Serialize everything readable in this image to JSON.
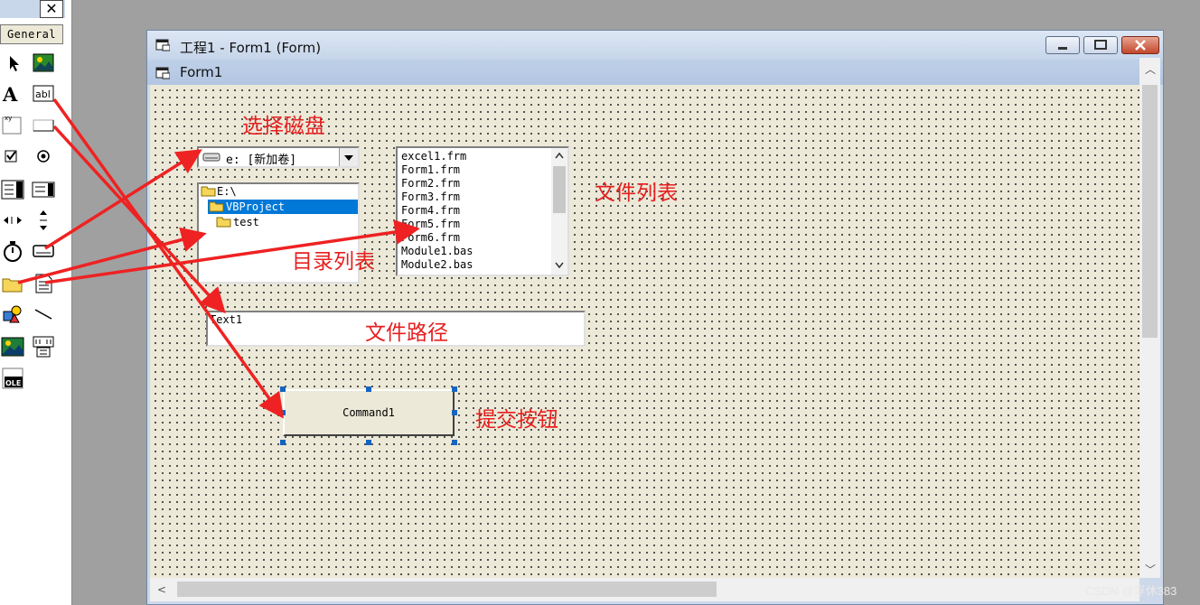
{
  "toolbox": {
    "tab_label": "General",
    "close_label": "✕",
    "tools": [
      {
        "name": "pointer-tool-icon"
      },
      {
        "name": "picturebox-tool-icon"
      },
      {
        "name": "label-tool-icon"
      },
      {
        "name": "textbox-tool-icon"
      },
      {
        "name": "frame-tool-icon"
      },
      {
        "name": "commandbutton-tool-icon"
      },
      {
        "name": "checkbox-tool-icon"
      },
      {
        "name": "optionbutton-tool-icon"
      },
      {
        "name": "combobox-tool-icon"
      },
      {
        "name": "listbox-tool-icon"
      },
      {
        "name": "hscrollbar-tool-icon"
      },
      {
        "name": "vscrollbar-tool-icon"
      },
      {
        "name": "timer-tool-icon"
      },
      {
        "name": "drivelistbox-tool-icon"
      },
      {
        "name": "dirlistbox-tool-icon"
      },
      {
        "name": "filelistbox-tool-icon"
      },
      {
        "name": "shape-tool-icon"
      },
      {
        "name": "line-tool-icon"
      },
      {
        "name": "image-tool-icon"
      },
      {
        "name": "data-tool-icon"
      },
      {
        "name": "ole-tool-icon"
      }
    ]
  },
  "window": {
    "title": "工程1 - Form1 (Form)",
    "form_caption": "Form1",
    "minimize_label": "▁",
    "maximize_label": "□",
    "close_label": "✕"
  },
  "controls": {
    "drive_value": "e: [新加卷]",
    "dir_items": [
      "E:\\",
      "VBProject",
      "test"
    ],
    "file_items": [
      "excel1.frm",
      "Form1.frm",
      "Form2.frm",
      "Form3.frm",
      "Form4.frm",
      "Form5.frm",
      "Form6.frm",
      "Module1.bas",
      "Module2.bas"
    ],
    "textbox_value": "Text1",
    "command_caption": "Command1"
  },
  "annotations": {
    "select_drive": "选择磁盘",
    "file_list": "文件列表",
    "dir_list": "目录列表",
    "file_path": "文件路径",
    "submit_button": "提交按钮"
  },
  "colors": {
    "annotation": "#e62020",
    "selection": "#0078d7",
    "selection_handle": "#1565c0"
  },
  "watermark": "CSDN @浮休383"
}
